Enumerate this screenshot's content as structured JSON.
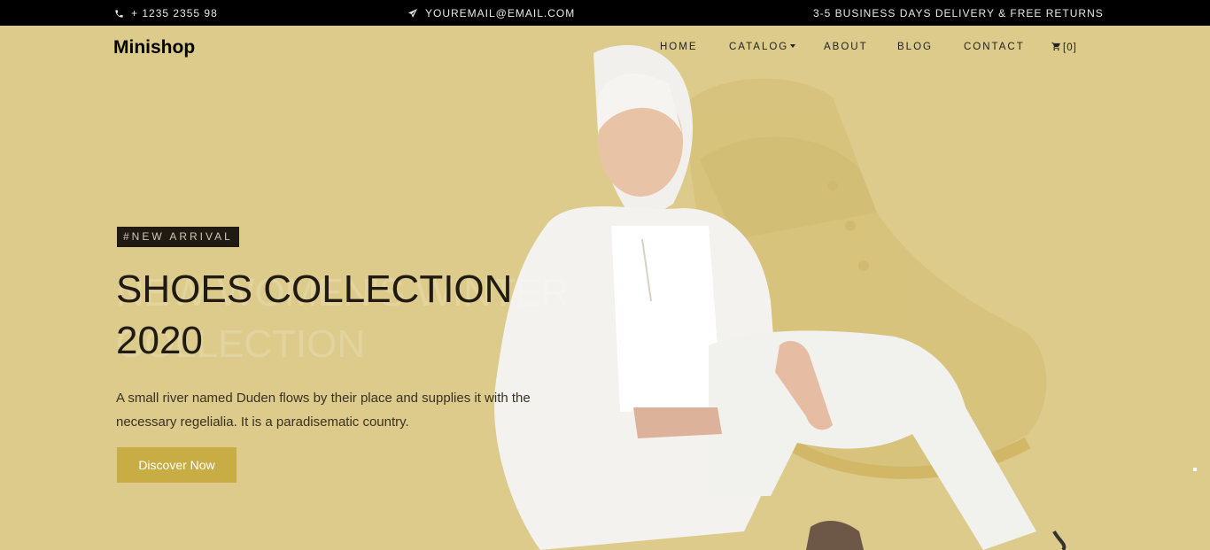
{
  "topbar": {
    "phone": "+ 1235 2355 98",
    "email": "YOUREMAIL@EMAIL.COM",
    "notice": "3-5 BUSINESS DAYS DELIVERY & FREE RETURNS"
  },
  "nav": {
    "brand": "Minishop",
    "items": [
      "HOME",
      "CATALOG",
      "ABOUT",
      "BLOG",
      "CONTACT"
    ],
    "cart_count": "[0]"
  },
  "hero": {
    "tag": "#NEW ARRIVAL",
    "ghost_line1": "NEW WOMEN'S WINTER",
    "ghost_line2": "COLLECTION",
    "title_line1": "SHOES COLLECTION",
    "title_line2": "2020",
    "description": "A small river named Duden flows by their place and supplies it with the necessary regelialia. It is a paradisematic country.",
    "cta_label": "Discover Now"
  },
  "colors": {
    "background": "#dccb8a",
    "topbar": "#000000",
    "button": "#c8ad45",
    "tag_bg": "#1f1a12"
  }
}
